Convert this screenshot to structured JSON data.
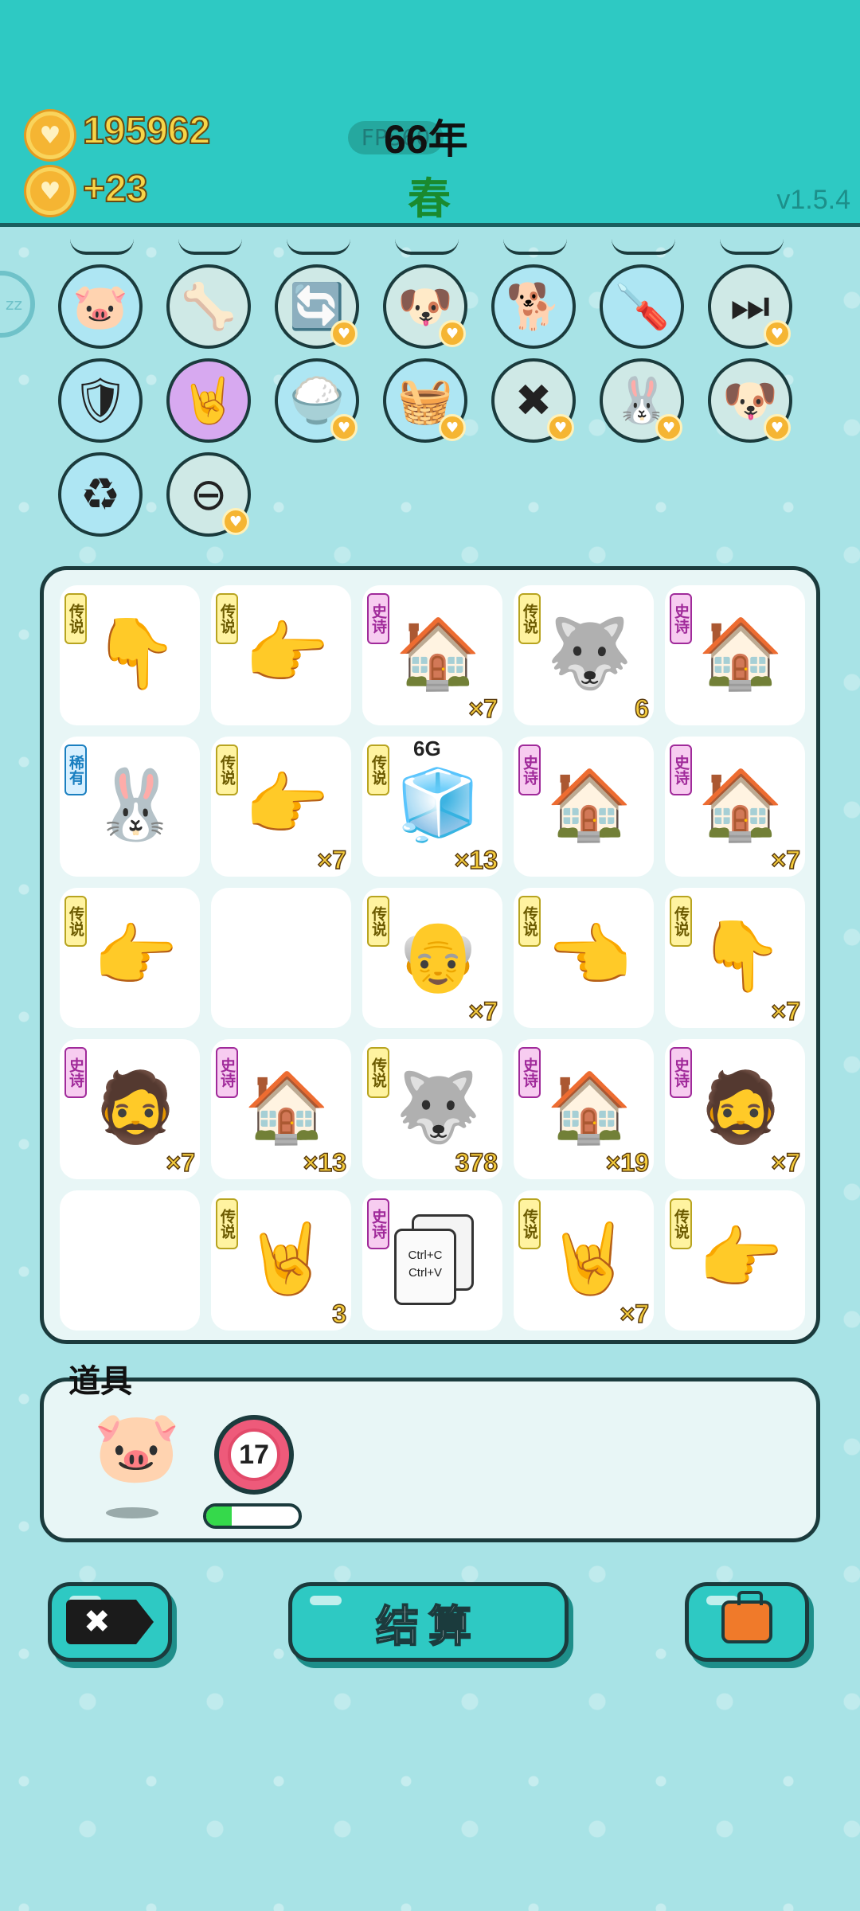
{
  "header": {
    "money": "195962",
    "income": "+23",
    "fps_label": "FPS60",
    "year": "66年",
    "season": "春",
    "version": "v1.5.4",
    "colors": {
      "header_bg": "#2ec9c3",
      "coin": "#f5b533",
      "money_text": "#f7d548",
      "season_text": "#1a8a2e"
    }
  },
  "side_button": {
    "label": "zz"
  },
  "upgrades": [
    {
      "icon": "piggy-bank-icon",
      "glyph": "🐷",
      "bg": "#aee6f3",
      "heart": false
    },
    {
      "icon": "pet-food-bowl-icon",
      "glyph": "🦴",
      "bg": "#cfe9e6",
      "heart": false
    },
    {
      "icon": "refresh-arrows-icon",
      "glyph": "🔄",
      "bg": "#cfe9e6",
      "heart": true
    },
    {
      "icon": "twin-dogs-icon",
      "glyph": "🐶",
      "bg": "#cfe9e6",
      "heart": true
    },
    {
      "icon": "cool-dog-icon",
      "glyph": "🐕",
      "bg": "#aee6f3",
      "heart": false
    },
    {
      "icon": "air-pump-icon",
      "glyph": "🪛",
      "bg": "#aee6f3",
      "heart": false
    },
    {
      "icon": "skip-icon",
      "glyph": "⏭",
      "bg": "#cfe9e6",
      "heart": true
    },
    {
      "icon": "shield-wrench-icon",
      "glyph": "🛡",
      "bg": "#aee6f3",
      "heart": false
    },
    {
      "icon": "rock-hand-icon",
      "glyph": "🤘",
      "bg": "#d7a9f0",
      "heart": false
    },
    {
      "icon": "rice-bowl-icon",
      "glyph": "🍚",
      "bg": "#aee6f3",
      "heart": true
    },
    {
      "icon": "fruit-basket-icon",
      "glyph": "🧺",
      "bg": "#aee6f3",
      "heart": true
    },
    {
      "icon": "remove-tag-icon",
      "glyph": "✖",
      "bg": "#cfe9e6",
      "heart": true
    },
    {
      "icon": "rabbit-icon",
      "glyph": "🐰",
      "bg": "#cfe9e6",
      "heart": true
    },
    {
      "icon": "twin-dogs-icon",
      "glyph": "🐶",
      "bg": "#cfe9e6",
      "heart": true
    },
    {
      "icon": "recycle-bag-icon",
      "glyph": "♻",
      "bg": "#aee6f3",
      "heart": false
    },
    {
      "icon": "minus-circle-icon",
      "glyph": "⊖",
      "bg": "#cfe9e6",
      "heart": true
    }
  ],
  "board": {
    "cells": [
      {
        "tag": "传说",
        "rarity": "leg",
        "icon": "pointing-hand-icon",
        "glyph": "👇",
        "count": ""
      },
      {
        "tag": "传说",
        "rarity": "leg",
        "icon": "pointing-hand-icon",
        "glyph": "👉",
        "count": ""
      },
      {
        "tag": "史诗",
        "rarity": "epic",
        "icon": "rabbit-house-icon",
        "glyph": "🏠",
        "count": "×7"
      },
      {
        "tag": "传说",
        "rarity": "leg",
        "icon": "husky-king-icon",
        "glyph": "🐺",
        "count": "6"
      },
      {
        "tag": "史诗",
        "rarity": "epic",
        "icon": "rabbit-house-icon",
        "glyph": "🏠",
        "count": ""
      },
      {
        "tag": "稀有",
        "rarity": "rare",
        "icon": "rabbit-icon",
        "glyph": "🐰",
        "count": ""
      },
      {
        "tag": "传说",
        "rarity": "leg",
        "icon": "pointing-hand-icon",
        "glyph": "👉",
        "count": "×7"
      },
      {
        "tag": "传说",
        "rarity": "leg",
        "icon": "fridge-icon",
        "glyph": "🧊",
        "count": "×13",
        "extra": "6G"
      },
      {
        "tag": "史诗",
        "rarity": "epic",
        "icon": "rabbit-house-icon",
        "glyph": "🏠",
        "count": ""
      },
      {
        "tag": "史诗",
        "rarity": "epic",
        "icon": "rabbit-house-icon",
        "glyph": "🏠",
        "count": "×7"
      },
      {
        "tag": "传说",
        "rarity": "leg",
        "icon": "pointing-hand-icon",
        "glyph": "👉",
        "count": ""
      },
      {
        "tag": "",
        "rarity": "",
        "icon": "",
        "glyph": "",
        "count": ""
      },
      {
        "tag": "传说",
        "rarity": "leg",
        "icon": "grandpa-face-icon",
        "glyph": "👴",
        "count": "×7"
      },
      {
        "tag": "传说",
        "rarity": "leg",
        "icon": "pointing-hand-icon",
        "glyph": "👈",
        "count": ""
      },
      {
        "tag": "传说",
        "rarity": "leg",
        "icon": "pointing-hand-icon",
        "glyph": "👇",
        "count": "×7"
      },
      {
        "tag": "史诗",
        "rarity": "epic",
        "icon": "bearded-man-icon",
        "glyph": "🧔",
        "count": "×7"
      },
      {
        "tag": "史诗",
        "rarity": "epic",
        "icon": "rabbit-house-icon",
        "glyph": "🏠",
        "count": "×13"
      },
      {
        "tag": "传说",
        "rarity": "leg",
        "icon": "husky-king-icon",
        "glyph": "🐺",
        "count": "378"
      },
      {
        "tag": "史诗",
        "rarity": "epic",
        "icon": "rabbit-house-icon",
        "glyph": "🏠",
        "count": "×19"
      },
      {
        "tag": "史诗",
        "rarity": "epic",
        "icon": "bearded-man-icon",
        "glyph": "🧔",
        "count": "×7"
      },
      {
        "tag": "",
        "rarity": "",
        "icon": "",
        "glyph": "",
        "count": ""
      },
      {
        "tag": "传说",
        "rarity": "leg",
        "icon": "rock-hand-icon",
        "glyph": "🤘",
        "count": "3"
      },
      {
        "tag": "史诗",
        "rarity": "epic",
        "icon": "copy-paste-card-icon",
        "glyph": "",
        "count": "",
        "ctrl_c": "Ctrl+C",
        "ctrl_v": "Ctrl+V"
      },
      {
        "tag": "传说",
        "rarity": "leg",
        "icon": "rock-hand-icon",
        "glyph": "🤘",
        "count": "×7"
      },
      {
        "tag": "传说",
        "rarity": "leg",
        "icon": "pointing-hand-icon",
        "glyph": "👉",
        "count": ""
      }
    ]
  },
  "items_panel": {
    "title": "道具",
    "counter_value": "17",
    "progress": 0.28
  },
  "buttons": {
    "settle_label": "结算"
  }
}
